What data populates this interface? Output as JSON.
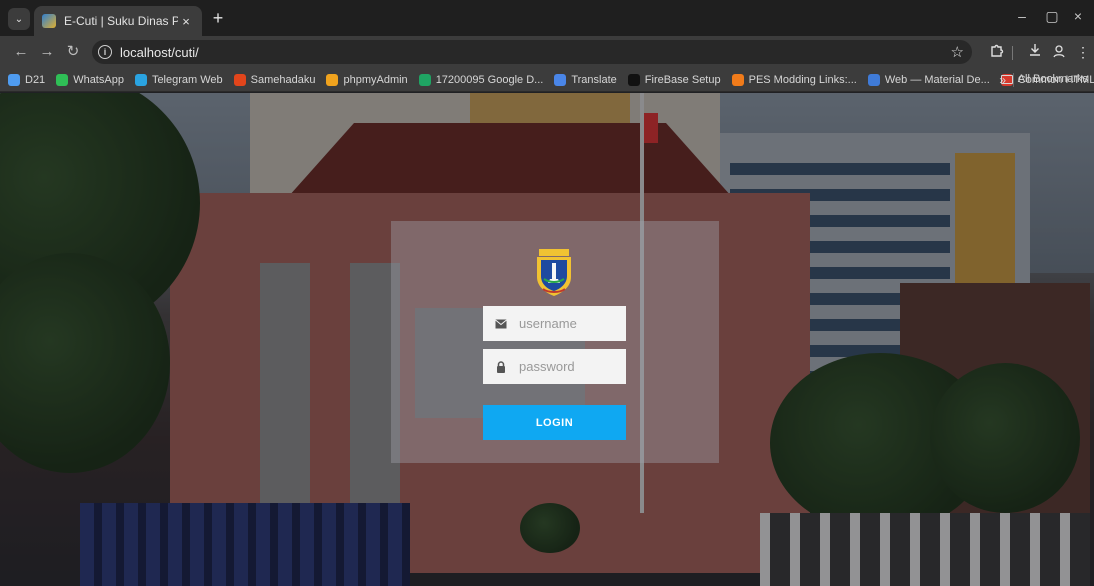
{
  "browser": {
    "tab": {
      "title": "E-Cuti | Suku Dinas Pendidikan",
      "close": "×"
    },
    "new_tab": "+",
    "window_controls": {
      "minimize": "–",
      "restore": "▢",
      "close": "×"
    },
    "toolbar": {
      "back": "←",
      "forward": "→",
      "reload": "↻",
      "url": "localhost/cuti/",
      "star": "☆",
      "extensions_icon": "puzzle-icon",
      "download_icon": "download-icon",
      "profile_icon": "profile-icon",
      "menu": "⋮"
    },
    "bookmarks": [
      {
        "label": "D21",
        "color": "#4f9cf0"
      },
      {
        "label": "WhatsApp",
        "color": "#2fbf56"
      },
      {
        "label": "Telegram Web",
        "color": "#2aa3e1"
      },
      {
        "label": "Samehadaku",
        "color": "#e2451b"
      },
      {
        "label": "phpmyAdmin",
        "color": "#f0a31e"
      },
      {
        "label": "17200095 Google D...",
        "color": "#1fa463"
      },
      {
        "label": "Translate",
        "color": "#4a86e8"
      },
      {
        "label": "FireBase Setup",
        "color": "#111111"
      },
      {
        "label": "PES Modding Links:...",
        "color": "#f07b1a"
      },
      {
        "label": "Web — Material De...",
        "color": "#3f7bd8"
      },
      {
        "label": "Common HTML Tag...",
        "color": "#d6392c"
      }
    ],
    "bookmarks_more": "»",
    "all_bookmarks": "All Bookmarks"
  },
  "login": {
    "logo": "jakarta-emblem-logo",
    "username_placeholder": "username",
    "password_placeholder": "password",
    "button_label": "LOGIN",
    "button_color": "#0fa8f2"
  }
}
